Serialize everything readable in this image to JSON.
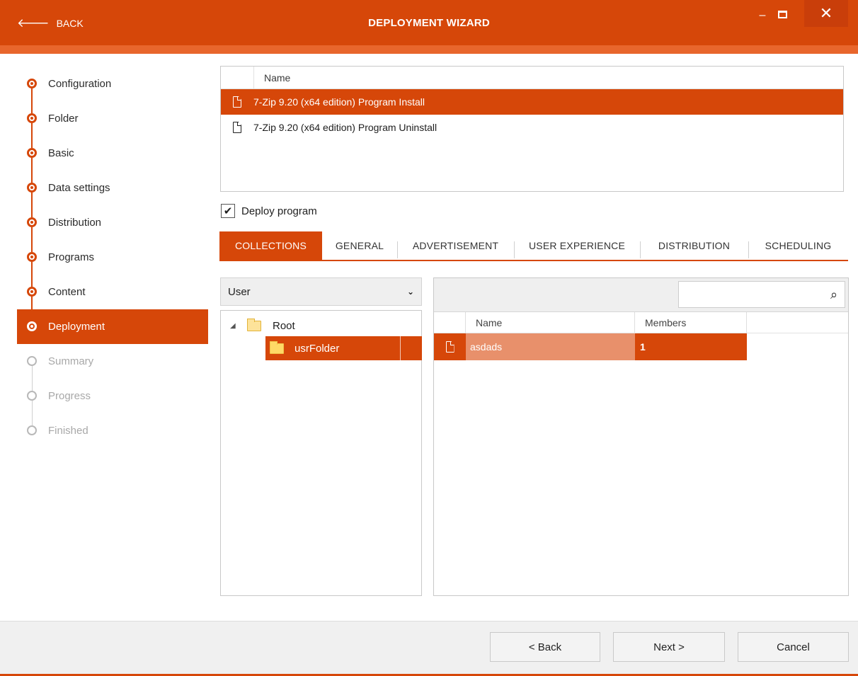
{
  "colors": {
    "accent": "#d64709",
    "accent_soft": "#e8906b",
    "band": "#e8662c"
  },
  "titlebar": {
    "back_label": "BACK",
    "back_icon": "arrow-left-icon",
    "title": "DEPLOYMENT WIZARD",
    "minimize_glyph": "–",
    "close_glyph": "✕"
  },
  "steps": [
    {
      "label": "Configuration",
      "state": "done"
    },
    {
      "label": "Folder",
      "state": "done"
    },
    {
      "label": "Basic",
      "state": "done"
    },
    {
      "label": "Data settings",
      "state": "done"
    },
    {
      "label": "Distribution",
      "state": "done"
    },
    {
      "label": "Programs",
      "state": "done"
    },
    {
      "label": "Content",
      "state": "done"
    },
    {
      "label": "Deployment",
      "state": "active"
    },
    {
      "label": "Summary",
      "state": "pending"
    },
    {
      "label": "Progress",
      "state": "pending"
    },
    {
      "label": "Finished",
      "state": "pending"
    }
  ],
  "programs": {
    "column": "Name",
    "rows": [
      {
        "name": "7-Zip 9.20 (x64 edition) Program Install",
        "selected": true,
        "icon": "file-icon"
      },
      {
        "name": "7-Zip 9.20 (x64 edition) Program Uninstall",
        "selected": false,
        "icon": "file-icon"
      }
    ]
  },
  "deploy_program": {
    "label": "Deploy program",
    "checked": true,
    "glyph": "✔"
  },
  "tabs": [
    {
      "label": "COLLECTIONS",
      "active": true
    },
    {
      "label": "GENERAL",
      "active": false
    },
    {
      "label": "ADVERTISEMENT",
      "active": false
    },
    {
      "label": "USER EXPERIENCE",
      "active": false
    },
    {
      "label": "DISTRIBUTION",
      "active": false
    },
    {
      "label": "SCHEDULING",
      "active": false
    }
  ],
  "collection_type": {
    "value": "User",
    "icon": "chevron-down-icon"
  },
  "tree": {
    "root": {
      "label": "Root",
      "expander": "◢",
      "icon": "folder-icon"
    },
    "child": {
      "label": "usrFolder",
      "selected": true,
      "icon": "folder-icon"
    }
  },
  "collections": {
    "search": {
      "value": "",
      "placeholder": "",
      "icon": "search-icon"
    },
    "columns": [
      "Name",
      "Members"
    ],
    "rows": [
      {
        "name": "asdads",
        "members": "1",
        "selected": true,
        "icon": "file-icon"
      }
    ]
  },
  "footer": {
    "back": "< Back",
    "next": "Next >",
    "cancel": "Cancel"
  }
}
